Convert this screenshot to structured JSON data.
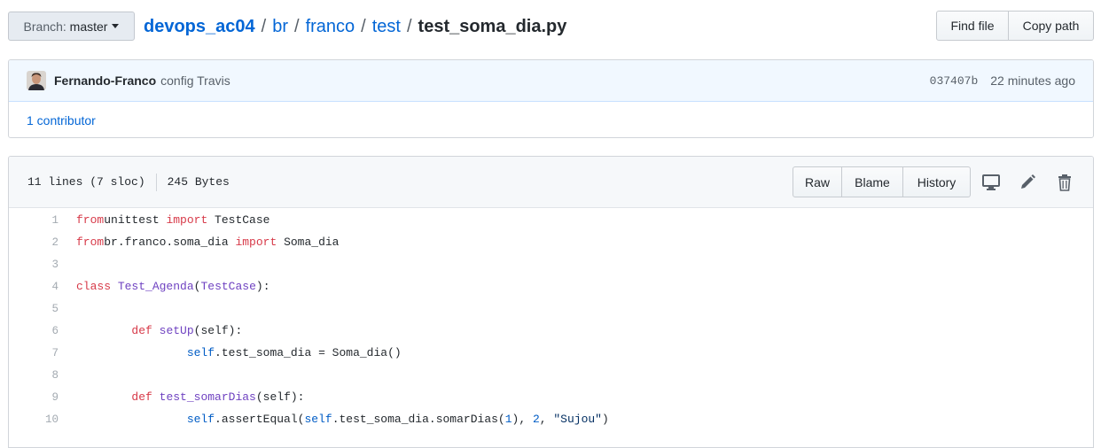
{
  "branch": {
    "prefix": "Branch:",
    "name": "master"
  },
  "breadcrumb": {
    "repo": "devops_ac04",
    "dirs": [
      "br",
      "franco",
      "test"
    ],
    "file": "test_soma_dia.py"
  },
  "file_actions": {
    "find_file": "Find file",
    "copy_path": "Copy path"
  },
  "commit": {
    "author": "Fernando-Franco",
    "message": "config Travis",
    "sha": "037407b",
    "time": "22 minutes ago",
    "contributors": "1 contributor"
  },
  "file_info": {
    "lines": "11 lines (7 sloc)",
    "size": "245 Bytes"
  },
  "view_buttons": {
    "raw": "Raw",
    "blame": "Blame",
    "history": "History"
  },
  "icons": [
    "desktop-icon",
    "pencil-icon",
    "trash-icon"
  ],
  "colors": {
    "link": "#0366d6",
    "keyword": "#d73a49",
    "entity": "#6f42c1",
    "constant": "#005cc5",
    "string": "#032f62"
  },
  "code": [
    {
      "n": "1",
      "tokens": [
        [
          "k",
          "from"
        ],
        [
          "",
          "unittest "
        ],
        [
          "k",
          "import"
        ],
        [
          "",
          " TestCase"
        ]
      ]
    },
    {
      "n": "2",
      "tokens": [
        [
          "k",
          "from"
        ],
        [
          "",
          "br.franco.soma_dia "
        ],
        [
          "k",
          "import"
        ],
        [
          "",
          " Soma_dia"
        ]
      ]
    },
    {
      "n": "3",
      "tokens": []
    },
    {
      "n": "4",
      "tokens": [
        [
          "k",
          "class"
        ],
        [
          "",
          " "
        ],
        [
          "e",
          "Test_Agenda"
        ],
        [
          "",
          "("
        ],
        [
          "e",
          "TestCase"
        ],
        [
          "",
          "):"
        ]
      ]
    },
    {
      "n": "5",
      "tokens": []
    },
    {
      "n": "6",
      "tokens": [
        [
          "",
          "        "
        ],
        [
          "k",
          "def"
        ],
        [
          "",
          " "
        ],
        [
          "e",
          "setUp"
        ],
        [
          "",
          "(self):"
        ]
      ]
    },
    {
      "n": "7",
      "tokens": [
        [
          "",
          "                "
        ],
        [
          "s1",
          "self"
        ],
        [
          "",
          ".test_soma_dia = Soma_dia()"
        ]
      ]
    },
    {
      "n": "8",
      "tokens": []
    },
    {
      "n": "9",
      "tokens": [
        [
          "",
          "        "
        ],
        [
          "k",
          "def"
        ],
        [
          "",
          " "
        ],
        [
          "e",
          "test_somarDias"
        ],
        [
          "",
          "(self):"
        ]
      ]
    },
    {
      "n": "10",
      "tokens": [
        [
          "",
          "                "
        ],
        [
          "s1",
          "self"
        ],
        [
          "",
          ".assertEqual("
        ],
        [
          "s1",
          "self"
        ],
        [
          "",
          ".test_soma_dia.somarDias("
        ],
        [
          "n",
          "1"
        ],
        [
          "",
          "), "
        ],
        [
          "n",
          "2"
        ],
        [
          "",
          ", "
        ],
        [
          "str",
          "\"Sujou\""
        ],
        [
          "",
          ")"
        ]
      ]
    }
  ]
}
